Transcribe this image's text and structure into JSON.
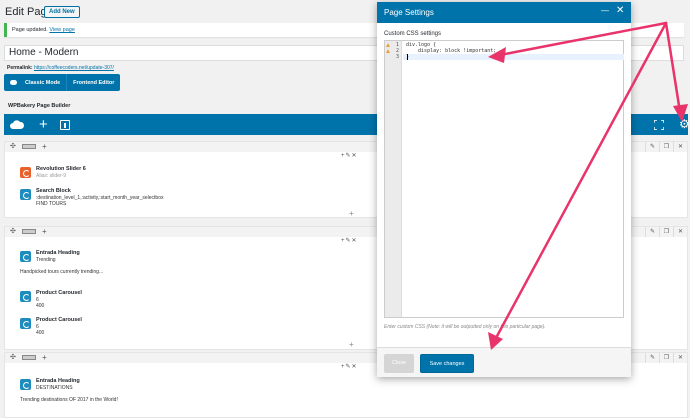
{
  "header": {
    "title": "Edit Page",
    "add_new": "Add New"
  },
  "notice": {
    "text": "Page updated.",
    "link": "View page"
  },
  "post": {
    "title": "Home - Modern"
  },
  "permalink": {
    "label": "Permalink:",
    "url": "https://coffeecoders.net/update-307/"
  },
  "modes": {
    "classic": "Classic Mode",
    "frontend": "Frontend Editor"
  },
  "builder": {
    "title": "WPBakery Page Builder"
  },
  "rows": [
    {
      "elements": [
        {
          "name": "Revolution Slider 6",
          "sub": "Alias: slider-9"
        },
        {
          "name": "Search Block",
          "sub": ":destination_level_1,:activity,:start_month_year_selectbox",
          "sub2": "FIND TOURS"
        }
      ]
    },
    {
      "elements": [
        {
          "name": "Entrada Heading",
          "sub": "Trending",
          "text": "Handpicked tours currently trending..."
        },
        {
          "name": "Product Carousel",
          "sub": "6",
          "sub2": "400"
        },
        {
          "name": "Product Carousel",
          "sub": "6",
          "sub2": "400"
        }
      ]
    },
    {
      "elements": [
        {
          "name": "Entrada Heading",
          "sub": "DESTINATIONS",
          "text": "Trending destinations OF 2017 in the World!"
        }
      ]
    }
  ],
  "modal": {
    "title": "Page Settings",
    "css_label": "Custom CSS settings",
    "code_lines": [
      "div.logo {",
      "    display: block !important;",
      "}"
    ],
    "line_numbers": [
      "1",
      "2",
      "3"
    ],
    "help": "Enter custom CSS (Note: it will be outputted only on this particular page).",
    "close": "Close",
    "save": "Save changes"
  },
  "colors": {
    "accent": "#0073aa",
    "arrow": "#e8346b",
    "warning": "#e8a23a"
  },
  "icons": [
    "gear-icon",
    "cloud-icon",
    "plus-icon",
    "template-icon",
    "fullscreen-icon",
    "minimize-icon",
    "close-icon",
    "warning-icon"
  ]
}
